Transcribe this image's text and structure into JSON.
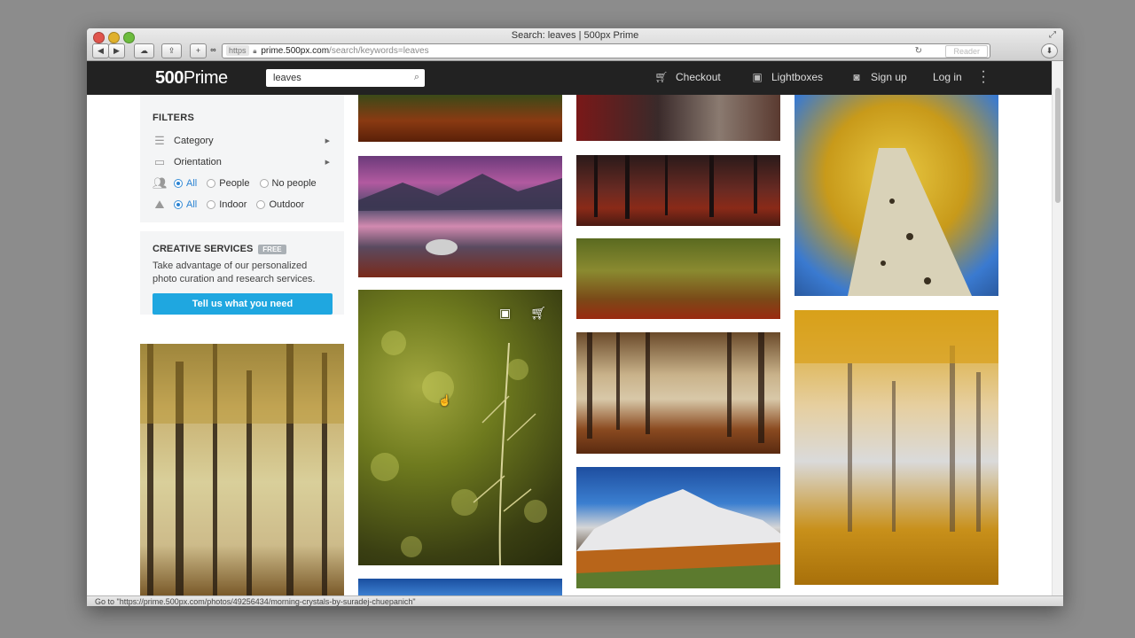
{
  "window": {
    "title": "Search: leaves | 500px Prime",
    "url_scheme": "https",
    "url_host": "prime.500px.com",
    "url_path": "/search/keywords=leaves",
    "reader_label": "Reader"
  },
  "nav": {
    "logo_num": "500",
    "logo_word": "Prime",
    "search_value": "leaves",
    "checkout": "Checkout",
    "lightboxes": "Lightboxes",
    "signup": "Sign up",
    "login": "Log in"
  },
  "filters": {
    "heading": "FILTERS",
    "category": "Category",
    "orientation": "Orientation",
    "people_options": [
      "All",
      "People",
      "No people"
    ],
    "place_options": [
      "All",
      "Indoor",
      "Outdoor"
    ]
  },
  "creative": {
    "heading": "CREATIVE SERVICES",
    "badge": "FREE",
    "text": "Take advantage of our personalized photo curation and research services.",
    "button": "Tell us what you need"
  },
  "status": "Go to \"https://prime.500px.com/photos/49256434/morning-crystals-by-suradej-chuepanich\"",
  "colors": {
    "nav_bg": "#222222",
    "accent": "#1fa7e0",
    "selected_radio": "#2a83d3"
  }
}
